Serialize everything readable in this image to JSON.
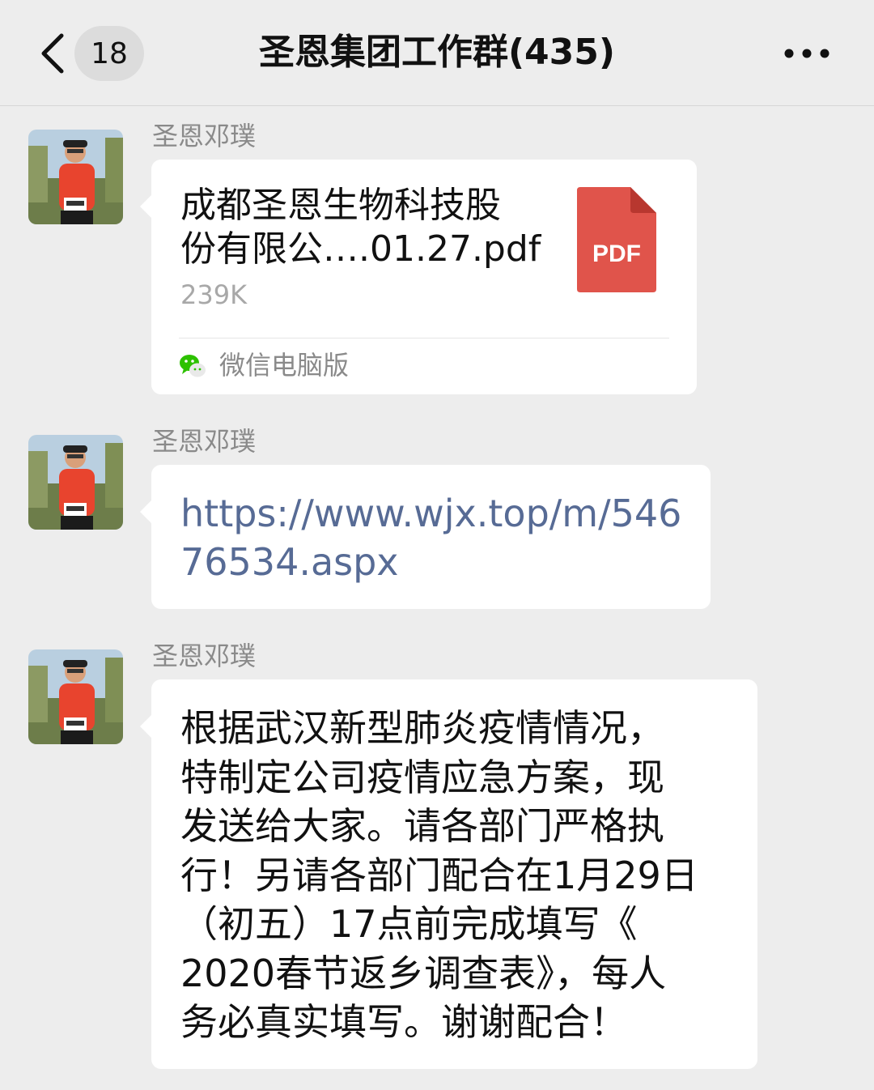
{
  "nav": {
    "back_label": "<",
    "unread_count": "18",
    "title": "圣恩集团工作群(435)",
    "more_label": "•••"
  },
  "messages": [
    {
      "sender": "圣恩邓璞",
      "type": "file",
      "file_name_lines": [
        "成都圣恩生物科技股",
        "份有限公….01.27.pdf"
      ],
      "file_size": "239K",
      "file_type": "PDF",
      "source": "微信电脑版"
    },
    {
      "sender": "圣恩邓璞",
      "type": "link",
      "link": "https://www.wjx.top/m/54676534.aspx"
    },
    {
      "sender": "圣恩邓璞",
      "type": "text",
      "lines": [
        "根据武汉新型肺炎疫情情况，",
        "特制定公司疫情应急方案，现",
        "发送给大家。请各部门严格执",
        "行！另请各部门配合在1月29日",
        "（初五）17点前完成填写《",
        "2020春节返乡调查表》，每人",
        "务必真实填写。谢谢配合！"
      ]
    }
  ],
  "colors": {
    "background": "#ededed",
    "bubble": "#ffffff",
    "link": "#576b95",
    "pdf": "#e0544b",
    "wechat_green": "#2dc100"
  },
  "icons": {
    "back": "chevron-left-icon",
    "more": "ellipsis-icon",
    "file": "pdf-icon",
    "source": "wechat-icon"
  }
}
